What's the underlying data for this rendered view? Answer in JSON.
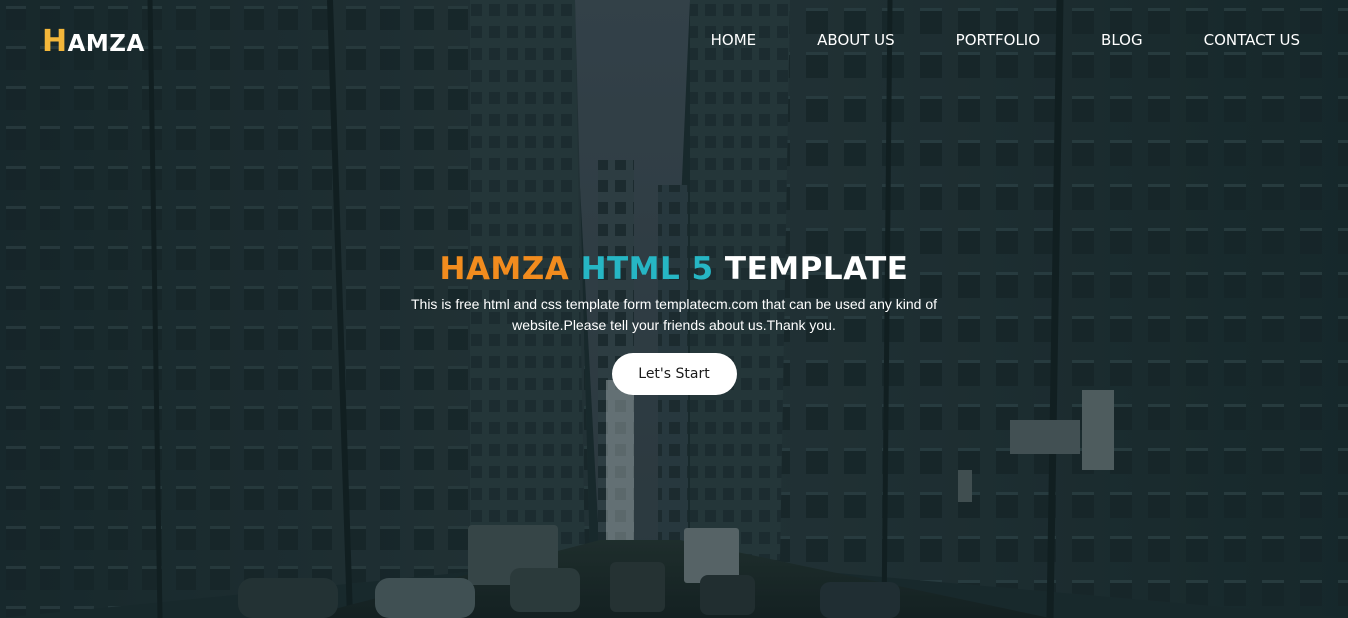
{
  "brand": {
    "initial": "H",
    "rest": "AMZA",
    "accent_color": "#f4b73a"
  },
  "nav": {
    "items": [
      {
        "label": "HOME"
      },
      {
        "label": "ABOUT US"
      },
      {
        "label": "PORTFOLIO"
      },
      {
        "label": "BLOG"
      },
      {
        "label": "CONTACT US"
      }
    ]
  },
  "hero": {
    "headline": {
      "part1": "HAMZA",
      "part1_color": "#f28c1e",
      "part2": "HTML 5",
      "part2_color": "#26b6c4",
      "part3": "TEMPLATE",
      "part3_color": "#ffffff"
    },
    "tagline": "This is free html and css template form templatecm.com that can be used any kind of website.Please tell your friends about us.Thank you.",
    "cta_label": "Let's Start",
    "background": "city-street-photo"
  }
}
